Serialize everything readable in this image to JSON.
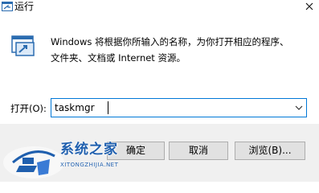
{
  "window": {
    "title": "运行"
  },
  "dialog": {
    "description_line1": "Windows 将根据你所输入的名称，为你打开相应的程序、",
    "description_line2": "文件夹、文档或 Internet 资源。",
    "open_label": "打开(O):",
    "open_value": "taskmgr"
  },
  "buttons": {
    "ok_label": "确定",
    "cancel_label": "取消",
    "browse_label": "浏览(B)..."
  },
  "watermark": {
    "name": "系统之家",
    "url": "XITONGZHIJIA.NET"
  },
  "colors": {
    "accent": "#0078d7",
    "footer_bg": "#f0f0f0",
    "button_bg": "#e1e1e1",
    "watermark": "#1f5fae"
  },
  "icons": {
    "title": "run-icon",
    "main": "run-icon",
    "close": "close-icon",
    "dropdown": "chevron-down-icon"
  }
}
